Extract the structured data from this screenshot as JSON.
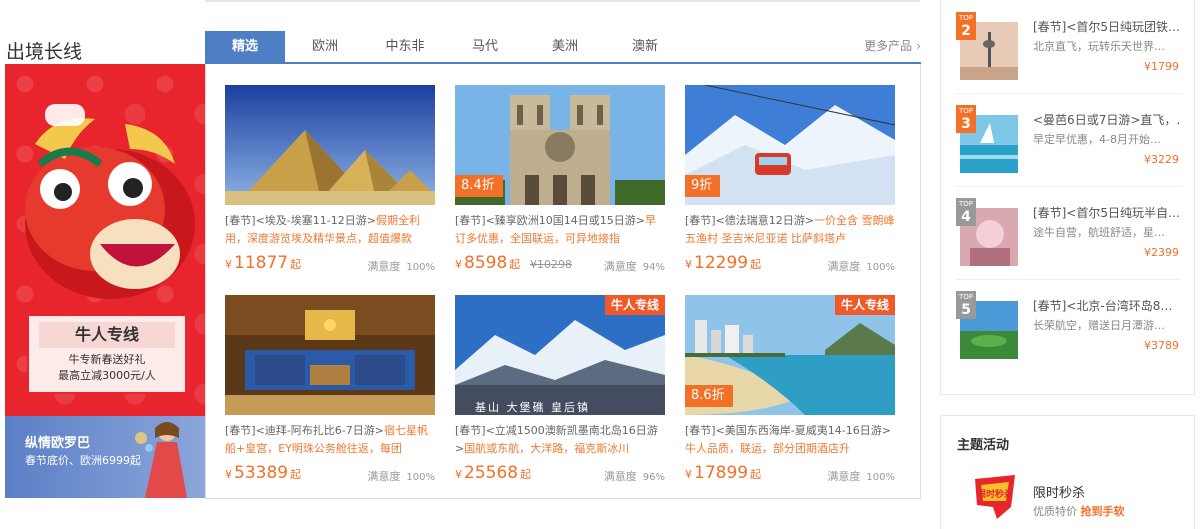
{
  "section": {
    "title": "出境长线",
    "more_label": "更多产品",
    "tabs": [
      "精选",
      "欧洲",
      "中东非",
      "马代",
      "美洲",
      "澳新"
    ]
  },
  "banner": {
    "promo_title": "牛人专线",
    "promo_line1": "牛专新春送好礼",
    "promo_line2": "最高立减3000元/人",
    "sub_title": "纵情欧罗巴",
    "sub_text": "春节底价、欧洲6999起"
  },
  "cards": [
    {
      "desc_tag": "[春节]",
      "desc_title": "<埃及-埃塞11-12日游>",
      "desc_hl": "假期全利用，深度游览埃及精华景点，超值爆款",
      "price": "11877",
      "old": "",
      "sat_label": "满意度",
      "sat": "100%",
      "discount": "",
      "badge": ""
    },
    {
      "desc_tag": "[春节]",
      "desc_title": "<臻享欧洲10国14日或15日游>",
      "desc_hl": "早订多优惠，全国联运，可异地接指",
      "price": "8598",
      "old": "¥10298",
      "sat_label": "满意度",
      "sat": "94%",
      "discount": "8.4折",
      "badge": ""
    },
    {
      "desc_tag": "[春节]",
      "desc_title": "<德法瑞意12日游>",
      "desc_hl": "一价全含 雪朗峰 五渔村 圣吉米尼亚诺 比萨斜塔卢",
      "price": "12299",
      "old": "",
      "sat_label": "满意度",
      "sat": "100%",
      "discount": "9折",
      "badge": ""
    },
    {
      "desc_tag": "[春节]",
      "desc_title": "<迪拜-阿布扎比6-7日游>",
      "desc_hl": "宿七星帆船+皇宫，EY明珠公务舱往返，每团",
      "price": "53389",
      "old": "",
      "sat_label": "满意度",
      "sat": "100%",
      "discount": "",
      "badge": ""
    },
    {
      "desc_tag": "[春节]",
      "desc_title": "<立减1500澳新凯墨南北岛16日游>",
      "desc_hl": "国航或东航，大洋路，福克斯冰川",
      "price": "25568",
      "old": "",
      "sat_label": "满意度",
      "sat": "96%",
      "discount": "",
      "badge": "牛人专线",
      "overlay": "基山 大堡礁 皇后镇"
    },
    {
      "desc_tag": "[春节]",
      "desc_title": "<美国东西海岸-夏威夷14-16日游>",
      "desc_hl": "牛人品质，联运，部分团期酒店升",
      "price": "17899",
      "old": "",
      "sat_label": "满意度",
      "sat": "100%",
      "discount": "8.6折",
      "badge": "牛人专线"
    }
  ],
  "price_symbol": "¥",
  "price_suffix": "起",
  "ranking": [
    {
      "top": "2",
      "title": "[春节]<首尔5日纯玩团铁…",
      "sub": "北京直飞，玩转乐天世界…",
      "price": "¥1799"
    },
    {
      "top": "3",
      "title": "<曼芭6日或7日游>直飞，…",
      "sub": "早定早优惠，4-8月开始…",
      "price": "¥3229"
    },
    {
      "top": "4",
      "title": "[春节]<首尔5日纯玩半自…",
      "sub": "途牛自营，航班舒适，星…",
      "price": "¥2399"
    },
    {
      "top": "5",
      "title": "[春节]<北京-台湾环岛8…",
      "sub": "长荣航空，赠送日月潭游…",
      "price": "¥3789"
    }
  ],
  "top_label": "TOP",
  "activity": {
    "heading": "主题活动",
    "title": "限时秒杀",
    "sub_a": "优质特价",
    "sub_b": "抢到手软",
    "logo_text": "限时秒杀"
  },
  "colors": {
    "accent": "#4e7fc4",
    "price": "#f37029",
    "banner_red": "#e8242c"
  }
}
